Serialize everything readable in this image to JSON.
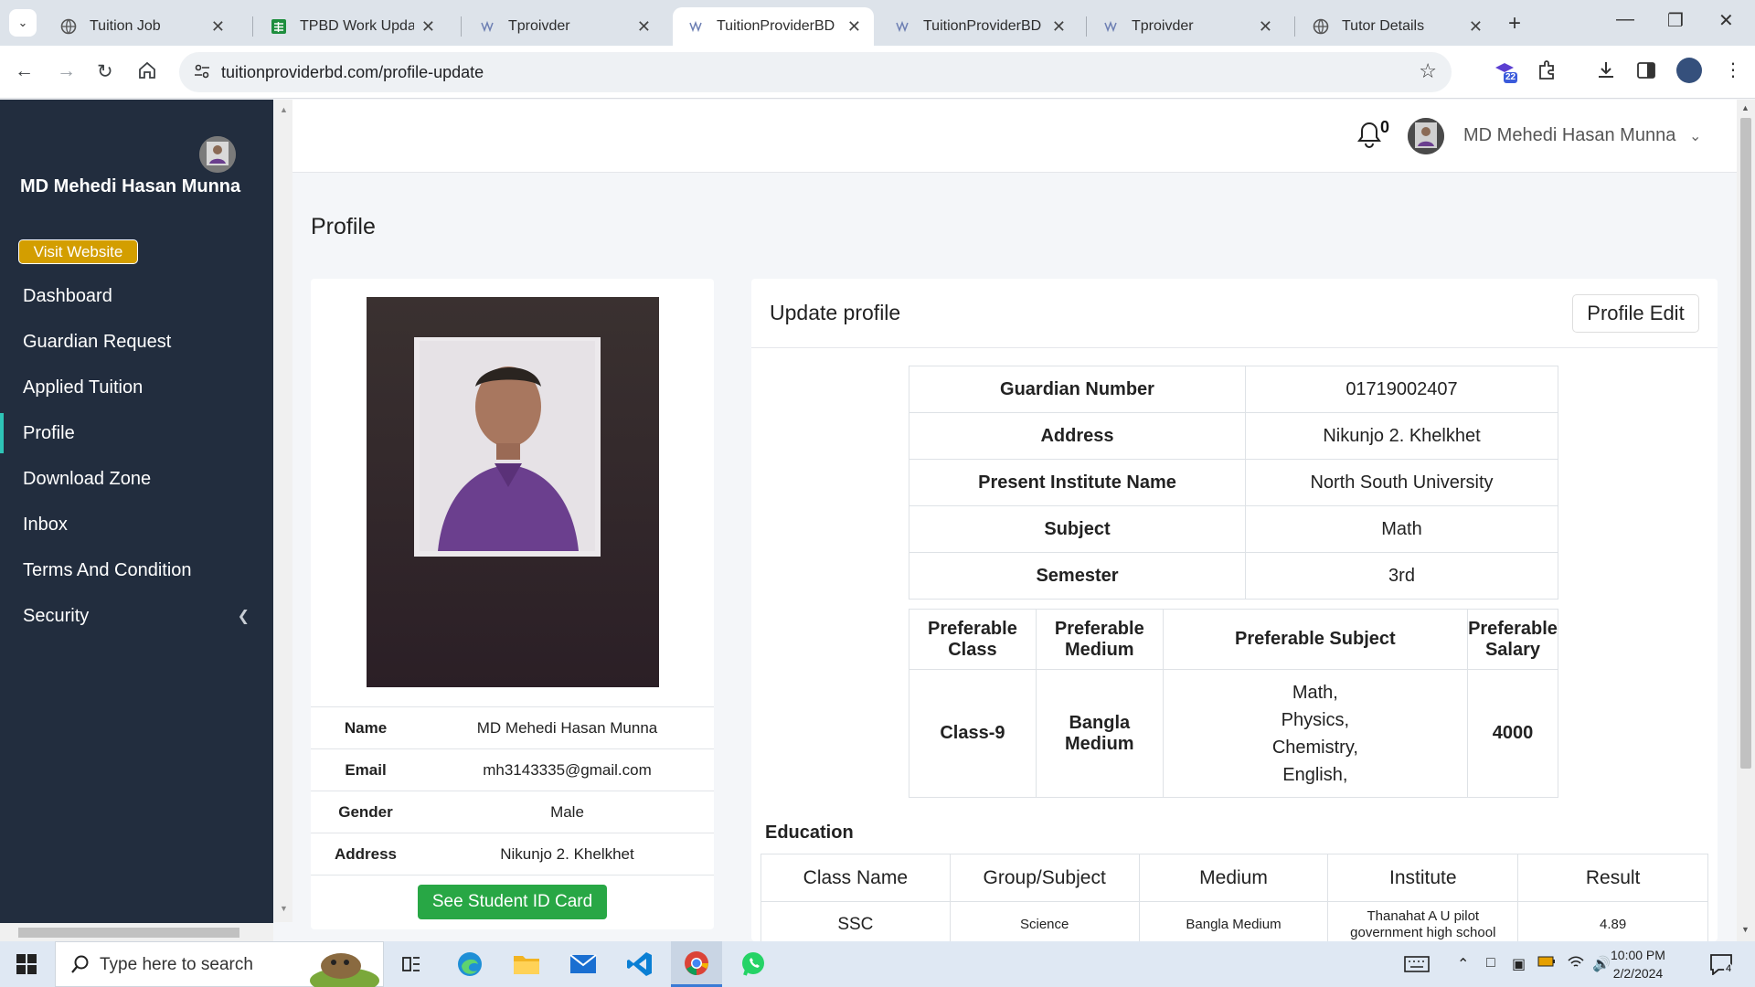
{
  "browser": {
    "tabs": [
      {
        "title": "Tuition Job",
        "icon": "globe-icon"
      },
      {
        "title": "TPBD Work Update -",
        "icon": "sheets-icon"
      },
      {
        "title": "Tproivder",
        "icon": "page-icon"
      },
      {
        "title": "TuitionProviderBD",
        "icon": "page-icon",
        "active": true
      },
      {
        "title": "TuitionProviderBD",
        "icon": "page-icon"
      },
      {
        "title": "Tproivder",
        "icon": "page-icon"
      },
      {
        "title": "Tutor Details",
        "icon": "globe-icon"
      }
    ],
    "url": "tuitionproviderbd.com/profile-update",
    "extension_badge": "22"
  },
  "sidebar": {
    "user_name": "MD Mehedi Hasan Munna",
    "visit_button": "Visit Website",
    "items": [
      {
        "label": "Dashboard"
      },
      {
        "label": "Guardian Request"
      },
      {
        "label": "Applied Tuition"
      },
      {
        "label": "Profile",
        "active": true
      },
      {
        "label": "Download Zone"
      },
      {
        "label": "Inbox"
      },
      {
        "label": "Terms And Condition"
      },
      {
        "label": "Security"
      }
    ]
  },
  "topbar": {
    "notification_count": "0",
    "user_name": "MD Mehedi Hasan Munna"
  },
  "page": {
    "title": "Profile"
  },
  "profile_card": {
    "rows": [
      {
        "label": "Name",
        "value": "MD Mehedi Hasan Munna"
      },
      {
        "label": "Email",
        "value": "mh3143335@gmail.com"
      },
      {
        "label": "Gender",
        "value": "Male"
      },
      {
        "label": "Address",
        "value": "Nikunjo 2. Khelkhet"
      }
    ],
    "id_button": "See Student ID Card"
  },
  "update_profile": {
    "title": "Update profile",
    "edit_button": "Profile Edit",
    "details": [
      {
        "label": "Guardian Number",
        "value": "01719002407"
      },
      {
        "label": "Address",
        "value": "Nikunjo 2. Khelkhet"
      },
      {
        "label": "Present Institute Name",
        "value": "North South University"
      },
      {
        "label": "Subject",
        "value": "Math"
      },
      {
        "label": "Semester",
        "value": "3rd"
      }
    ],
    "preferences": {
      "headers": [
        "Preferable Class",
        "Preferable Medium",
        "Preferable Subject",
        "Preferable Salary"
      ],
      "class": "Class-9",
      "medium": "Bangla Medium",
      "subjects": [
        "Math,",
        "Physics,",
        "Chemistry,",
        "English,"
      ],
      "salary": "4000"
    },
    "education": {
      "title": "Education",
      "headers": [
        "Class Name",
        "Group/Subject",
        "Medium",
        "Institute",
        "Result"
      ],
      "rows": [
        [
          "SSC",
          "Science",
          "Bangla Medium",
          "Thanahat A U pilot government high school",
          "4.89"
        ]
      ]
    }
  },
  "taskbar": {
    "search_placeholder": "Type here to search",
    "time": "10:00 PM",
    "date": "2/2/2024",
    "notification_badge": "4"
  }
}
